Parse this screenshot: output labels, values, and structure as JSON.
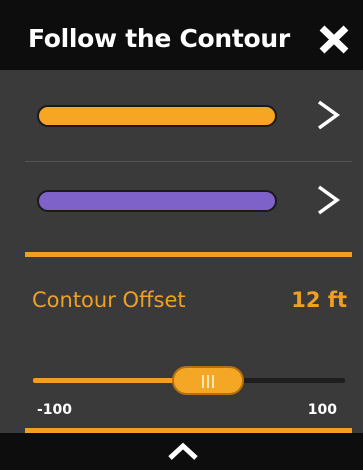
{
  "header": {
    "title": "Follow the Contour",
    "close_icon": "close-icon"
  },
  "lines": [
    {
      "color_name": "orange",
      "color": "#f6a623",
      "chevron_icon": "chevron-right-icon"
    },
    {
      "color_name": "purple",
      "color": "#7e62c9",
      "chevron_icon": "chevron-right-icon"
    }
  ],
  "offset": {
    "label": "Contour Offset",
    "value": "12 ft"
  },
  "slider": {
    "min_label": "-100",
    "max_label": "100",
    "min": -100,
    "max": 100,
    "value": 12
  },
  "footer": {
    "collapse_icon": "chevron-up-icon"
  },
  "colors": {
    "accent": "#f0a020",
    "background": "#3a3a3a",
    "header": "#0d0d0d"
  }
}
